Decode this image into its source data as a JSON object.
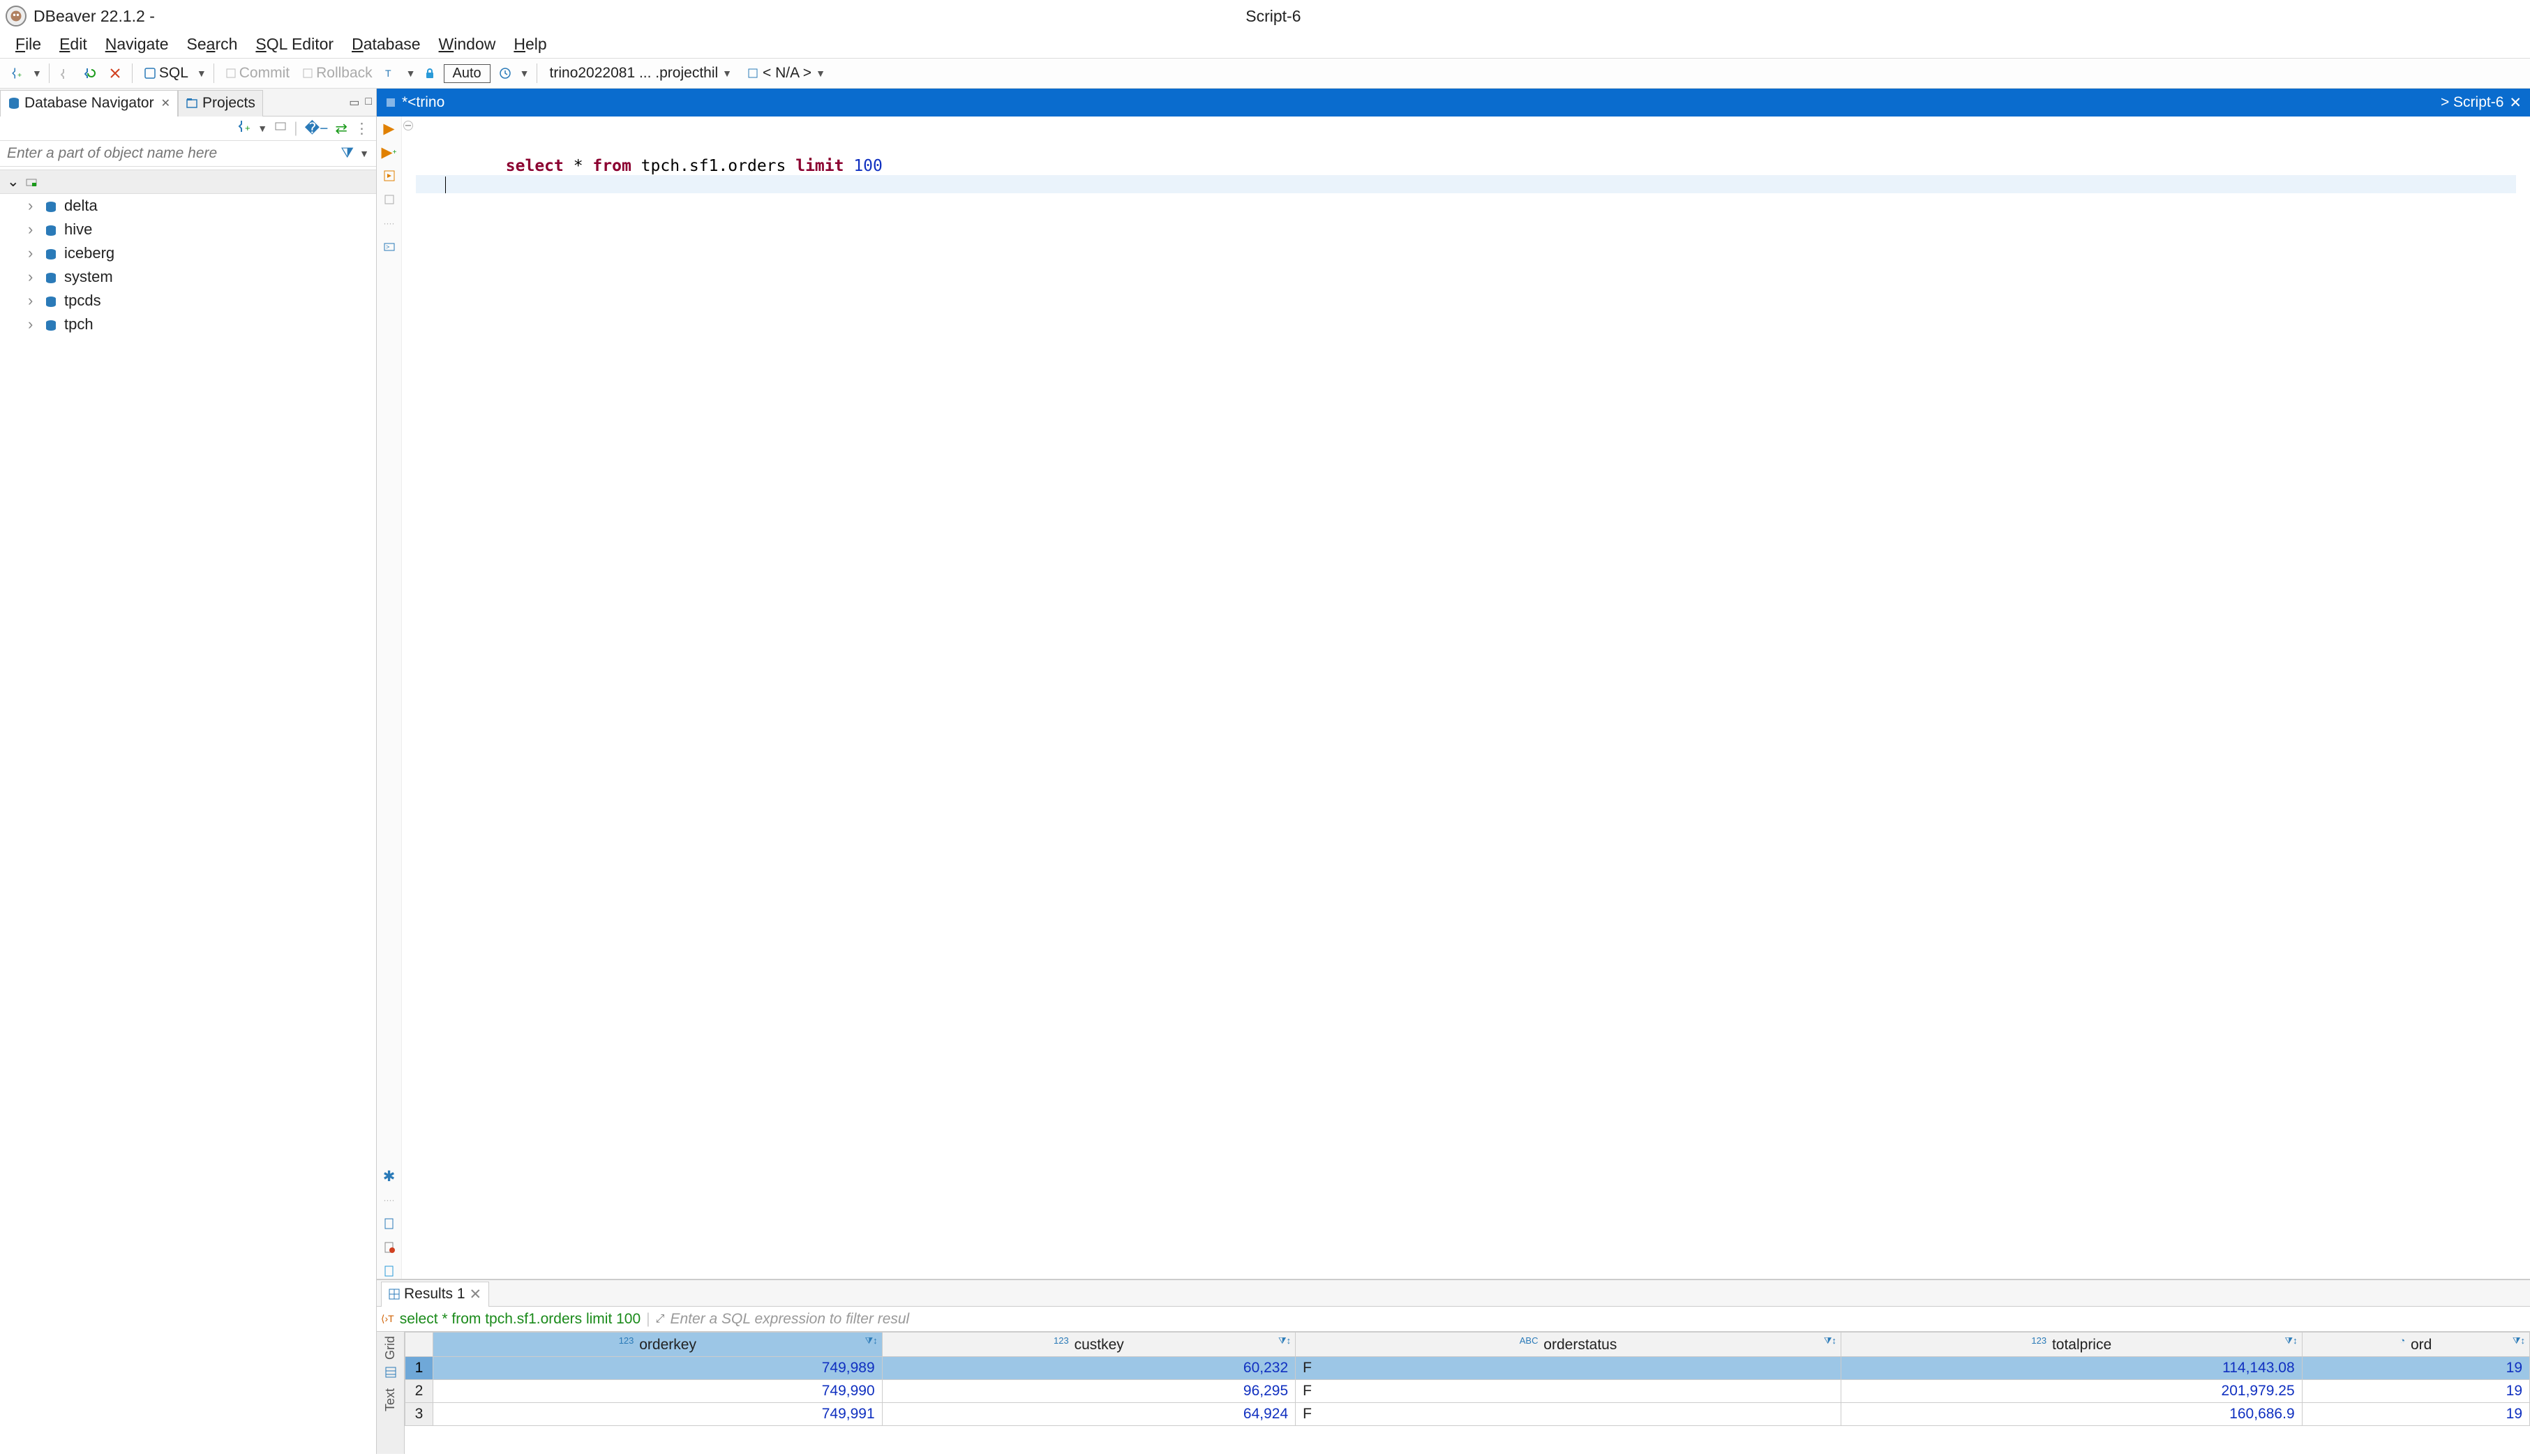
{
  "title": {
    "app": "DBeaver 22.1.2 -",
    "doc": "Script-6"
  },
  "menu": {
    "file": "File",
    "edit": "Edit",
    "navigate": "Navigate",
    "search": "Search",
    "sql": "SQL Editor",
    "database": "Database",
    "window": "Window",
    "help": "Help"
  },
  "toolbar": {
    "sql": "SQL",
    "commit": "Commit",
    "rollback": "Rollback",
    "auto": "Auto",
    "connection": "trino2022081 ... .projecthil",
    "schema": "< N/A >"
  },
  "left": {
    "tab_nav": "Database Navigator",
    "tab_proj": "Projects",
    "filter_placeholder": "Enter a part of object name here",
    "catalogs": [
      "delta",
      "hive",
      "iceberg",
      "system",
      "tpcds",
      "tpch"
    ]
  },
  "editor": {
    "tab_left": "*<trino",
    "tab_right": "> Script-6",
    "code_tokens": [
      {
        "t": "select",
        "c": "kw"
      },
      {
        "t": " * ",
        "c": "id"
      },
      {
        "t": "from",
        "c": "kw"
      },
      {
        "t": " tpch.sf1.orders ",
        "c": "id"
      },
      {
        "t": "limit",
        "c": "kw"
      },
      {
        "t": " ",
        "c": "id"
      },
      {
        "t": "100",
        "c": "num"
      }
    ]
  },
  "results": {
    "tab": "Results 1",
    "echo": "select * from tpch.sf1.orders limit 100",
    "filter_hint": "Enter a SQL expression to filter resul",
    "side_labels": {
      "grid": "Grid",
      "text": "Text"
    },
    "columns": [
      {
        "name": "orderkey",
        "type": "123"
      },
      {
        "name": "custkey",
        "type": "123"
      },
      {
        "name": "orderstatus",
        "type": "ABC"
      },
      {
        "name": "totalprice",
        "type": "123"
      },
      {
        "name": "ord",
        "type": "clock"
      }
    ],
    "rows": [
      {
        "n": 1,
        "orderkey": "749,989",
        "custkey": "60,232",
        "orderstatus": "F",
        "totalprice": "114,143.08",
        "ord": "19"
      },
      {
        "n": 2,
        "orderkey": "749,990",
        "custkey": "96,295",
        "orderstatus": "F",
        "totalprice": "201,979.25",
        "ord": "19"
      },
      {
        "n": 3,
        "orderkey": "749,991",
        "custkey": "64,924",
        "orderstatus": "F",
        "totalprice": "160,686.9",
        "ord": "19"
      }
    ],
    "selected_row": 0
  }
}
